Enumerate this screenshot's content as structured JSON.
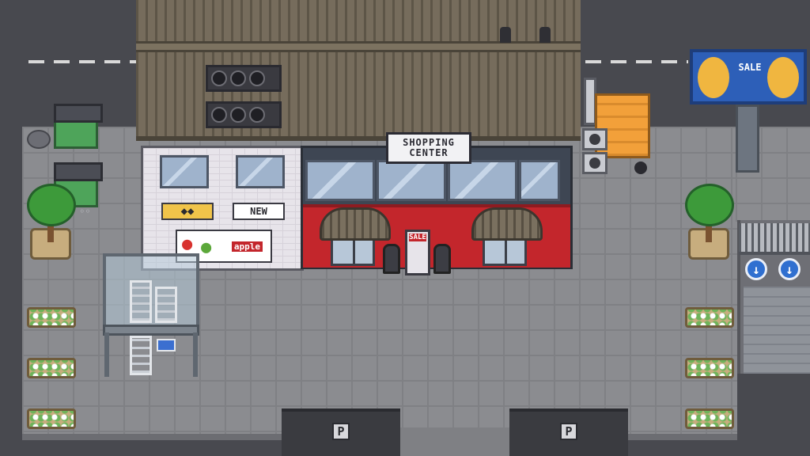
{
  "scene": {
    "type": "pixel-art top-down shopping plaza",
    "palette": {
      "store_red": "#c3262c",
      "roof_brown": "#6c6354",
      "billboard_blue": "#2d5fb8",
      "truck_orange": "#f2a03a",
      "dumpster_green": "#4ea45a",
      "pavement_gray": "#8b8c90",
      "road_dark": "#48494f"
    }
  },
  "store": {
    "sign_line1": "SHOPPING",
    "sign_line2": "CENTER",
    "sale_stand_label": "SALE"
  },
  "posters": {
    "new_label": "NEW",
    "apple_label": "apple"
  },
  "billboard": {
    "label": "SALE"
  },
  "parking": {
    "sign_a": "P",
    "sign_b": "P"
  },
  "garage": {
    "arrow_glyph": "↓"
  }
}
